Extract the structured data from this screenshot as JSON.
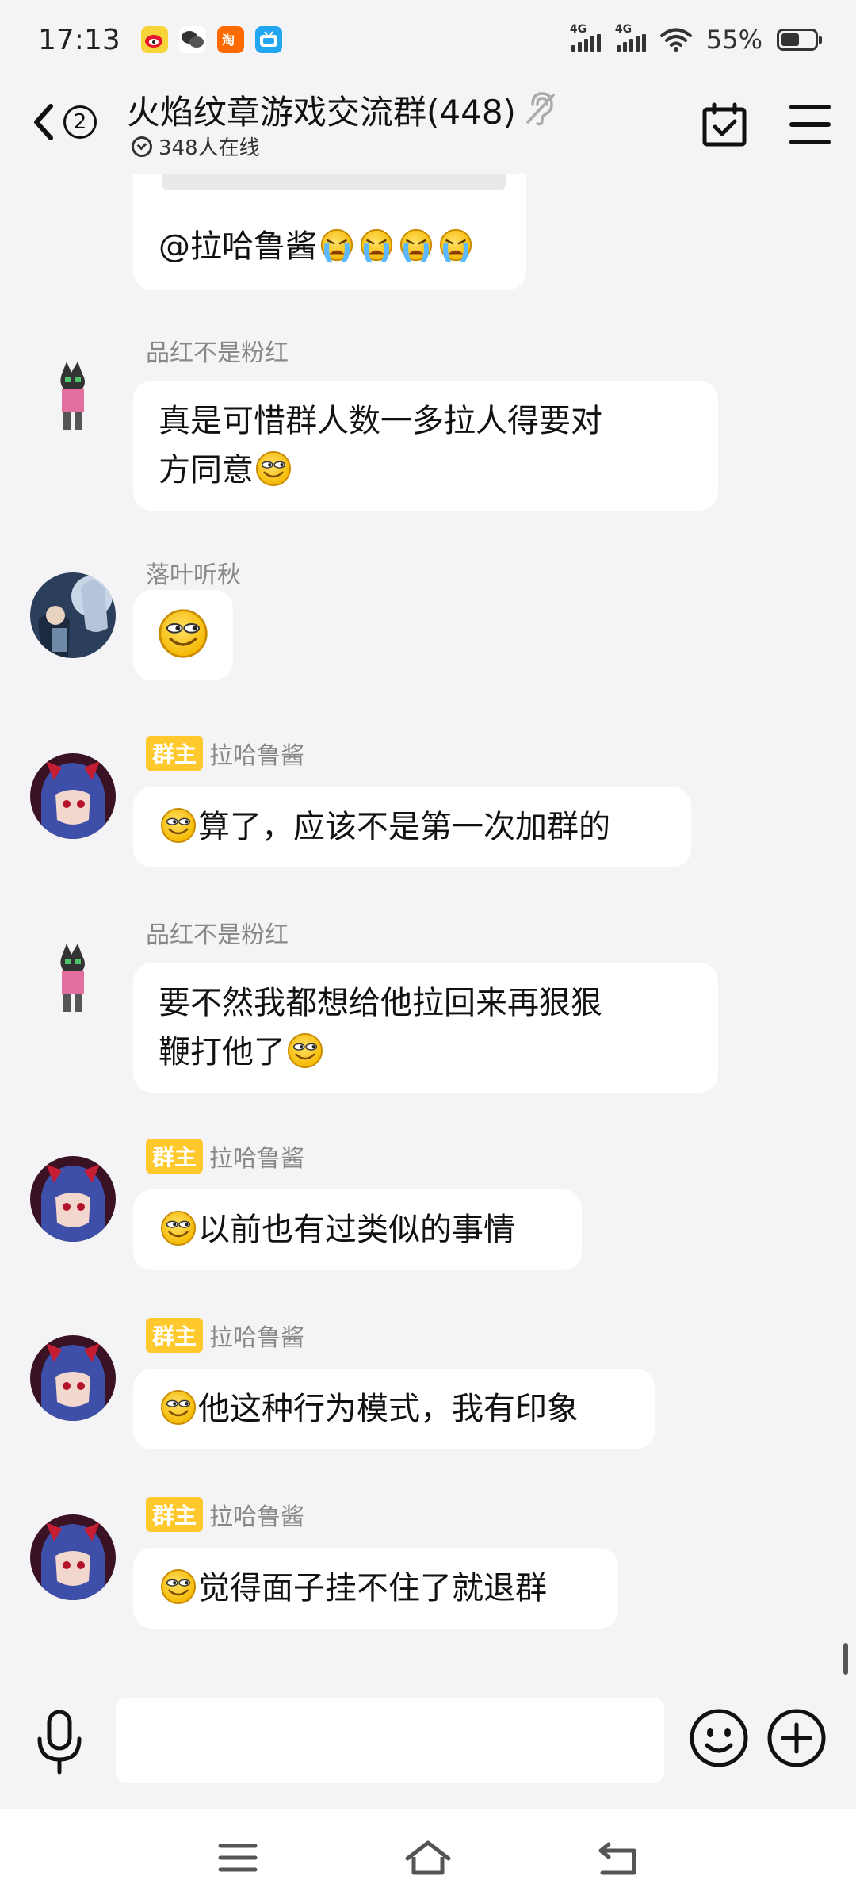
{
  "status_bar": {
    "time": "17:13",
    "network_1": "4G",
    "network_2": "4G",
    "battery_percent": "55%",
    "battery_level": 0.55
  },
  "header": {
    "back_unread_count": "2",
    "title": "火焰纹章游戏交流群(448)",
    "online_status": "348人在线"
  },
  "messages": [
    {
      "sender": "",
      "text": "@拉哈鲁酱",
      "emojis": [
        "crying-emoji",
        "crying-emoji",
        "crying-emoji",
        "crying-emoji"
      ]
    },
    {
      "sender": "品红不是粉红",
      "text_line1": "真是可惜群人数一多拉人得要对",
      "text_line2": "方同意",
      "emojis": [
        "smirk-emoji"
      ]
    },
    {
      "sender": "落叶听秋",
      "text": "",
      "emojis": [
        "smirk-emoji"
      ]
    },
    {
      "badge": "群主",
      "sender": "拉哈鲁酱",
      "text": "算了，应该不是第一次加群的",
      "emojis": [
        "smirk-emoji"
      ]
    },
    {
      "sender": "品红不是粉红",
      "text_line1": "要不然我都想给他拉回来再狠狠",
      "text_line2": "鞭打他了",
      "emojis": [
        "smirk-emoji"
      ]
    },
    {
      "badge": "群主",
      "sender": "拉哈鲁酱",
      "text": "以前也有过类似的事情",
      "emojis": [
        "smirk-emoji"
      ]
    },
    {
      "badge": "群主",
      "sender": "拉哈鲁酱",
      "text": "他这种行为模式，我有印象",
      "emojis": [
        "smirk-emoji"
      ]
    },
    {
      "badge": "群主",
      "sender": "拉哈鲁酱",
      "text": "觉得面子挂不住了就退群",
      "emojis": [
        "smirk-emoji"
      ]
    }
  ],
  "input_bar": {
    "placeholder": ""
  },
  "colors": {
    "background": "#f4f4f6",
    "bubble": "#ffffff",
    "owner_badge": "#ffc82c",
    "sender_name": "#888888"
  }
}
